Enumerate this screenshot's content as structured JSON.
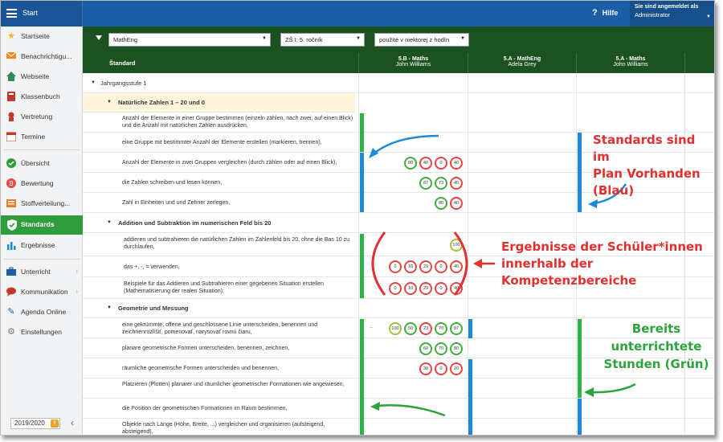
{
  "topbar": {
    "start_label": "Start",
    "help_label": "Hilfe",
    "user_line1": "Sie sind angemeldet als",
    "user_line2": "Administrator"
  },
  "sidebar": {
    "items": [
      {
        "label": "Startseite",
        "icon": "star-icon",
        "color": "#f2b01e"
      },
      {
        "label": "Benachrichtigu...",
        "icon": "envelope-icon",
        "color": "#f08a24"
      },
      {
        "label": "Webseite",
        "icon": "house-icon",
        "color": "#2e8b57"
      },
      {
        "label": "Klassenbuch",
        "icon": "book-icon",
        "color": "#c0392b"
      },
      {
        "label": "Vertretung",
        "icon": "substitute-icon",
        "color": "#c0392b"
      },
      {
        "label": "Termine",
        "icon": "calendar-icon",
        "color": "#c0392b"
      },
      {
        "label": "Übersicht",
        "icon": "check-circle-icon",
        "color": "#2e9d3d"
      },
      {
        "label": "Bewertung",
        "icon": "rating-icon",
        "color": "#e74c3c"
      },
      {
        "label": "Stoffverteilung...",
        "icon": "distribution-icon",
        "color": "#e67e22"
      },
      {
        "label": "Standards",
        "icon": "shield-check-icon",
        "color": "#ffffff"
      },
      {
        "label": "Ergebnisse",
        "icon": "bar-chart-icon",
        "color": "#1d89d8"
      },
      {
        "label": "Unterricht",
        "icon": "briefcase-icon",
        "color": "#1b5ea5"
      },
      {
        "label": "Kommunikation",
        "icon": "chat-icon",
        "color": "#c0392b"
      },
      {
        "label": "Agenda Online",
        "icon": "pen-icon",
        "color": "#1b5ea5"
      },
      {
        "label": "Einstellungen",
        "icon": "gear-icon",
        "color": "#777777"
      }
    ],
    "year": "2019/2020"
  },
  "filters": {
    "subject": "MathEng",
    "grade": "ZŠ I: 5. ročník",
    "usage": "použité v niektorej z hodín"
  },
  "table": {
    "standard_header": "Štandard",
    "columns": [
      {
        "class": "5.B - Maths",
        "teacher": "John Williams"
      },
      {
        "class": "5.A - MathEng",
        "teacher": "Adela Grey"
      },
      {
        "class": "5.A - Maths",
        "teacher": "John Williams"
      }
    ],
    "level": "Jahrgangsstufe 1",
    "groups": [
      {
        "title": "Natürliche Zahlen 1 – 20 und 0"
      },
      {
        "title": "Addition und Subtraktion im numerischen Feld bis 20"
      },
      {
        "title": "Geometrie und Messung"
      }
    ],
    "standards": [
      "Anzahl der Elemente in einer Gruppe bestimmen (einzeln zählen, nach zwei, auf einen Blick) und die Anzahl mit natürlichen Zahlen ausdrücken,",
      "eine Gruppe mit bestimmter Anzahl der Elemente erstellen (markieren, trennen),",
      "Anzahl der Elemente in zwei Gruppen vergleichen (durch zählen oder auf einen Blick),",
      "die Zahlen schreiben und lesen können,",
      "Zahl in Einheiten und und Zehner zerlegen,",
      "addieren und subtrahieren die natürlichen Zahlen im Zahlenfeld bis 20, ohne die Bas 10 zu durchlaufen,",
      "das +, -, = verwenden,",
      "Beispiele für das Addieren und Subtrahieren einer gegebenen Situation erstellen (Mathematisierung der realen Situation);",
      "eine gekrümmte, offene und geschlossene Linie unterscheiden, benennen und zeichnenrozlíšiť, pomenovať, narysovať rovnú čiaru,",
      "planare geometrische Formen unterscheiden, benennen, zeichnen,",
      "räumliche geometrische Formen unterscheiden und benennen,",
      "Platzieren (Plotten) planarer und räumlicher geometrischer Formationen wie angewiesen,",
      "die Position der geometrischen Formationen im Raum bestimmen,",
      "Objekte nach Länge (Höhe, Breite, ...) vergleichen und organisieren (aufsteigend, absteigend),"
    ],
    "scores": [
      [],
      [],
      [
        "80",
        "40",
        "0",
        "40"
      ],
      [
        "87",
        "73",
        "40"
      ],
      [
        "80",
        "40"
      ],
      [
        "100"
      ],
      [
        "0",
        "10",
        "29",
        "0",
        "40"
      ],
      [
        "0",
        "10",
        "29",
        "0",
        "40"
      ],
      [
        "100",
        "50",
        "23",
        "70",
        "87"
      ],
      [
        "60",
        "70",
        "80"
      ],
      [
        "30",
        "0",
        "20"
      ],
      [],
      [],
      []
    ]
  },
  "annotations": {
    "blue": [
      "Standards sind im",
      "Plan Vorhanden",
      "(Blau)"
    ],
    "red": [
      "Ergebnisse der Schüler*innen",
      "innerhalb der",
      "Kompetenzbereiche"
    ],
    "green": [
      "Bereits",
      "unterrichtete",
      "Stunden (Grün)"
    ]
  },
  "colors": {
    "brand_blue": "#1b5ea5",
    "table_green": "#1c5220",
    "active_green": "#2e9d3d",
    "plan_blue": "#1d89d8",
    "taught_green": "#2fb24a",
    "annotation_red": "#e03030"
  }
}
